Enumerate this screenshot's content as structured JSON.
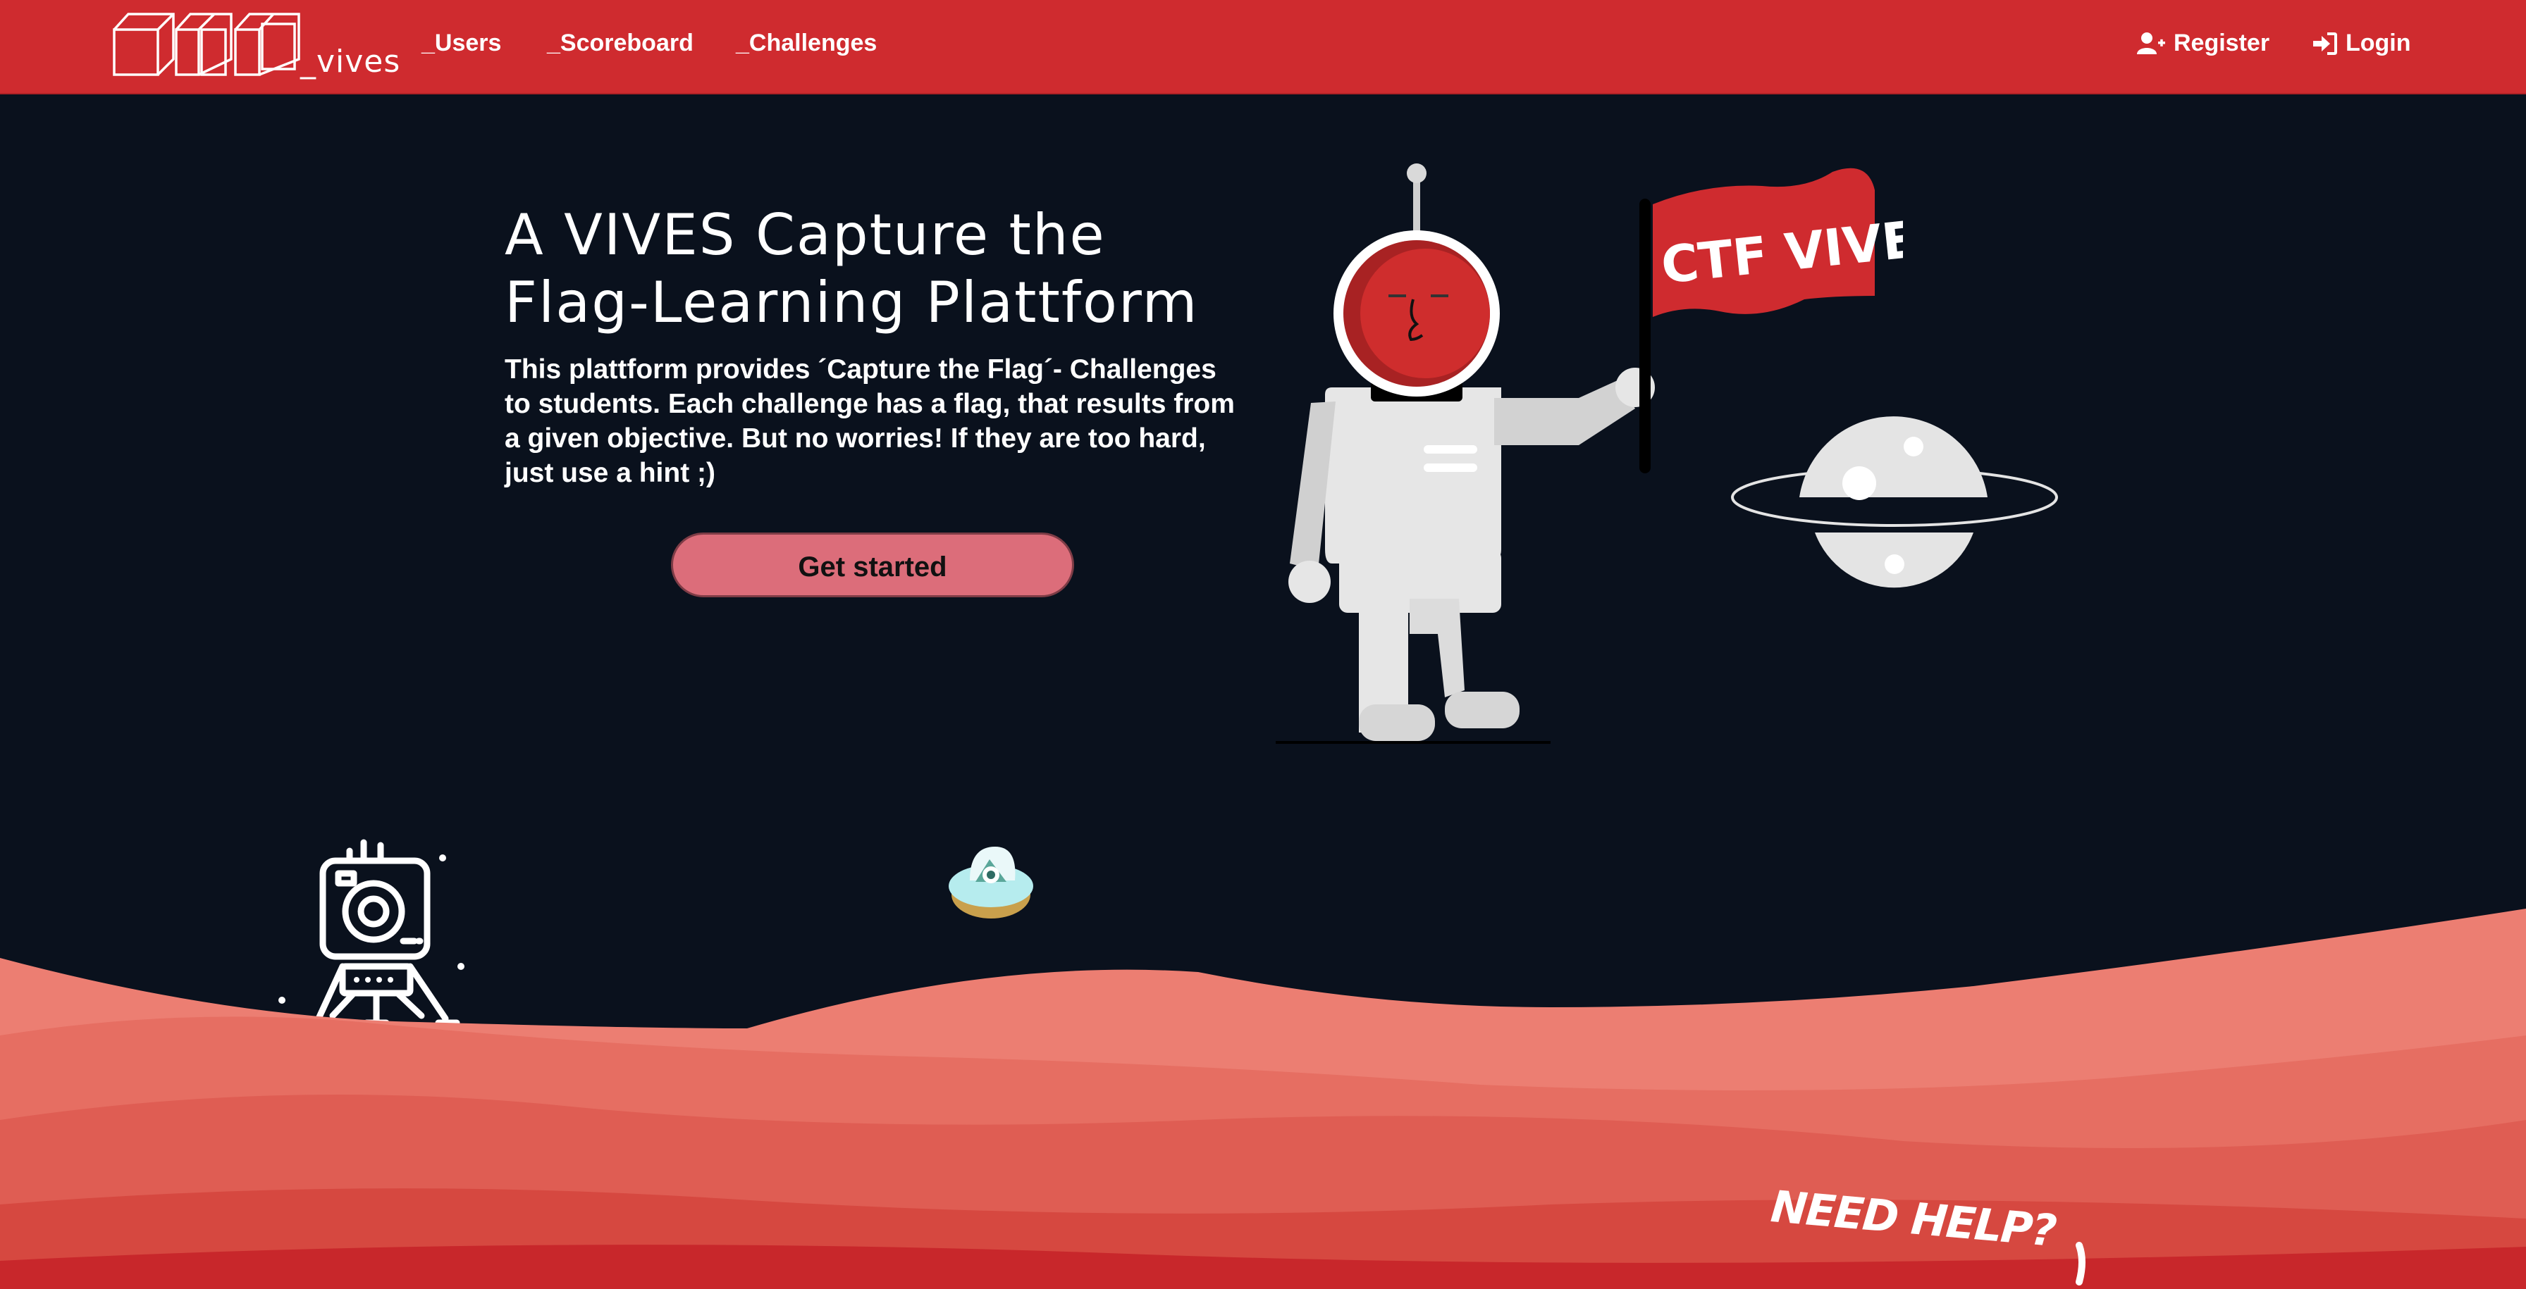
{
  "nav": {
    "logo_suffix": "_vives",
    "links": [
      "_Users",
      "_Scoreboard",
      "_Challenges"
    ],
    "register_label": "Register",
    "login_label": "Login",
    "register_icon": "user-plus-icon",
    "login_icon": "sign-in-icon"
  },
  "hero": {
    "title_line1": "A VIVES Capture the",
    "title_line2": "Flag-Learning Plattform",
    "description": "This plattform provides ´Capture the Flag´- Challenges to students. Each challenge has a flag, that results from a given objective. But no worries! If they are too hard, just use a hint ;)",
    "cta_label": "Get started"
  },
  "illustration": {
    "flag_text": "CTF VIVES",
    "help_text": "NEED HELP?"
  },
  "colors": {
    "nav_bg": "#cf2b2f",
    "page_bg": "#0a111d",
    "cta_bg": "#dc6d7a",
    "dune_light": "#e9786c",
    "dune_dark": "#c8272b"
  }
}
